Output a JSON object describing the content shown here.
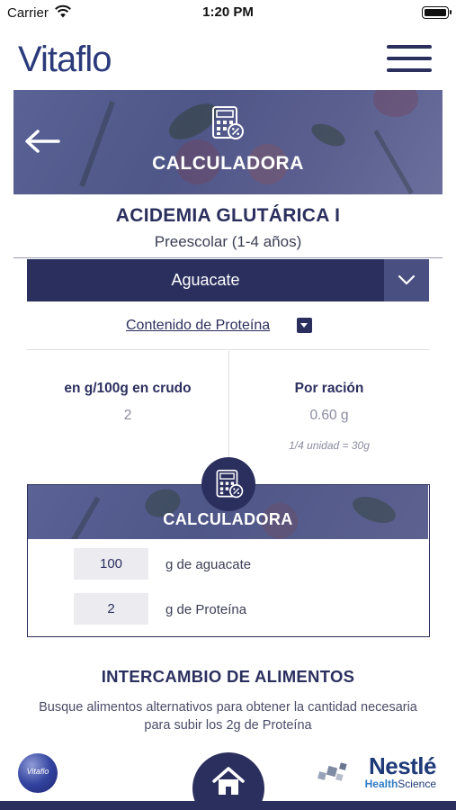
{
  "status_bar": {
    "carrier": "Carrier",
    "time": "1:20 PM"
  },
  "header": {
    "logo": "Vitaflo"
  },
  "banner": {
    "title": "CALCULADORA"
  },
  "disease": {
    "title": "ACIDEMIA GLUTÁRICA I",
    "age_group": "Preescolar (1-4 años)"
  },
  "food_select": {
    "selected": "Aguacate"
  },
  "nutrient": {
    "label": "Contenido de Proteína"
  },
  "columns": {
    "per_100g": {
      "heading": "en g/100g en crudo",
      "value": "2"
    },
    "per_serving": {
      "heading": "Por ración",
      "value": "0.60 g",
      "note": "1/4 unidad = 30g"
    }
  },
  "calculator": {
    "title": "CALCULADORA",
    "food_amount": "100",
    "food_label": "g de aguacate",
    "protein_amount": "2",
    "protein_label": "g de Proteína"
  },
  "exchange": {
    "title": "INTERCAMBIO DE ALIMENTOS",
    "description": "Busque alimentos alternativos para obtener la cantidad necesaria para subir los 2g de Proteína"
  },
  "footer": {
    "left_logo": "Vitaflo",
    "brand_name": "Nestlé",
    "brand_health": "Health",
    "brand_science": "Science"
  },
  "colors": {
    "primary": "#2b2f5e",
    "banner": "#525a8c",
    "input_bg": "#ececf0",
    "muted": "#8a8ba0"
  }
}
